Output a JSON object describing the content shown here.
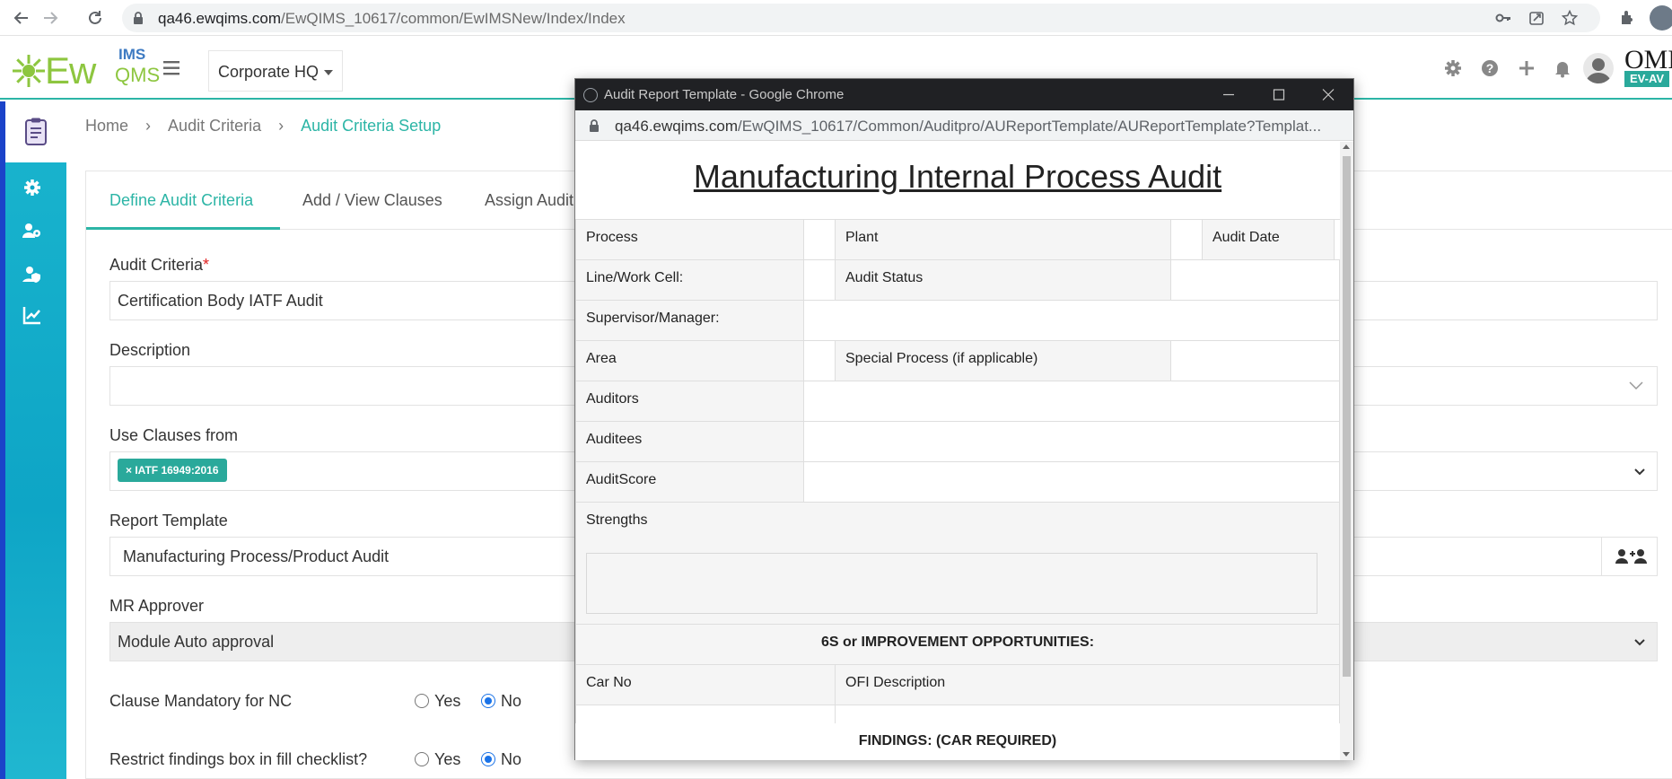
{
  "browser": {
    "url_host": "qa46.ewqims.com",
    "url_path": "/EwQIMS_10617/common/EwIMSNew/Index/Index"
  },
  "header": {
    "logo_ew": "Ew",
    "logo_ims": "IMS",
    "logo_qms": "QMS",
    "company": "Corporate HQ",
    "brand": "OMN",
    "brand_badge": "EV-AV"
  },
  "breadcrumb": {
    "items": [
      "Home",
      "Audit Criteria",
      "Audit Criteria Setup"
    ]
  },
  "tabs": [
    "Define Audit Criteria",
    "Add / View Clauses",
    "Assign Audit"
  ],
  "form": {
    "audit_criteria_label": "Audit Criteria",
    "audit_criteria_required": "*",
    "audit_criteria_value": "Certification Body IATF Audit",
    "description_label": "Description",
    "description_value": "",
    "use_clauses_label": "Use Clauses from",
    "clause_tag": "× IATF 16949:2016",
    "report_template_label": "Report Template",
    "report_template_value": "Manufacturing Process/Product Audit",
    "mr_approver_label": "MR Approver",
    "mr_approver_value": "Module Auto approval",
    "clause_mandatory_label": "Clause Mandatory for NC",
    "restrict_findings_label": "Restrict findings box in fill checklist?",
    "yes_label": "Yes",
    "no_label": "No",
    "clause_mandatory_selected": "No",
    "restrict_findings_selected": "No"
  },
  "popup": {
    "window_title": "Audit Report Template - Google Chrome",
    "url_host": "qa46.ewqims.com",
    "url_path": "/EwQIMS_10617/Common/Auditpro/AUReportTemplate/AUReportTemplate?Templat...",
    "report_title": "Manufacturing Internal Process Audit",
    "labels": {
      "process": "Process",
      "plant": "Plant",
      "audit_date": "Audit Date",
      "line_work_cell": "Line/Work Cell:",
      "audit_status": "Audit Status",
      "supervisor": "Supervisor/Manager:",
      "area": "Area",
      "special_process": "Special Process (if applicable)",
      "auditors": "Auditors",
      "auditees": "Auditees",
      "audit_score": "AuditScore",
      "strengths": "Strengths",
      "improvement_header": "6S or IMPROVEMENT OPPORTUNITIES:",
      "car_no": "Car No",
      "ofi_description": "OFI Description",
      "findings_header": "FINDINGS: (CAR REQUIRED)"
    }
  },
  "icons": {
    "back": "arrow-left-icon",
    "forward": "arrow-right-icon",
    "reload": "reload-icon",
    "settings": "gear-icon",
    "help": "question-icon",
    "add": "plus-icon",
    "notifications": "bell-icon"
  },
  "colors": {
    "accent": "#2cb5a6",
    "sidebar": "#0ea5c6",
    "sidebar_stripe": "#1b43c9",
    "tag": "#2aa99b",
    "popup_titlebar": "#202124"
  }
}
